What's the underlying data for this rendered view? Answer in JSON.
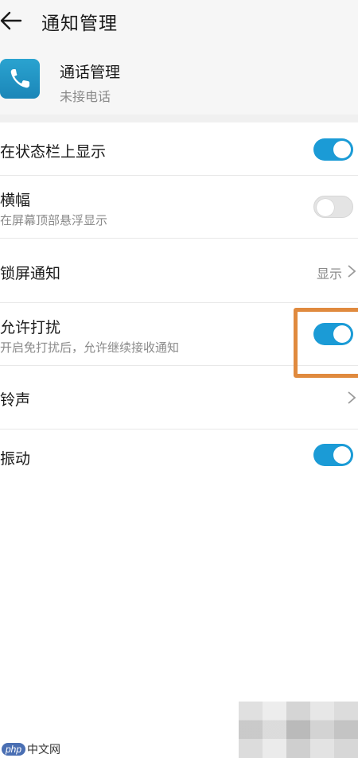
{
  "header": {
    "title": "通知管理"
  },
  "app": {
    "name": "通话管理",
    "subtitle": "未接电话"
  },
  "settings": [
    {
      "title": "在状态栏上显示",
      "toggle": true
    },
    {
      "title": "横幅",
      "subtitle": "在屏幕顶部悬浮显示",
      "toggle": false
    },
    {
      "title": "锁屏通知",
      "value": "显示"
    },
    {
      "title": "允许打扰",
      "subtitle": "开启免打扰后，允许继续接收通知",
      "toggle": true
    },
    {
      "title": "铃声"
    },
    {
      "title": "振动",
      "toggle": true
    }
  ],
  "watermark": {
    "badge": "php",
    "text": "中文网"
  },
  "colors": {
    "toggle_on": "#1b9bd6",
    "highlight": "#e08a3e",
    "app_icon": "#1f95c6"
  }
}
